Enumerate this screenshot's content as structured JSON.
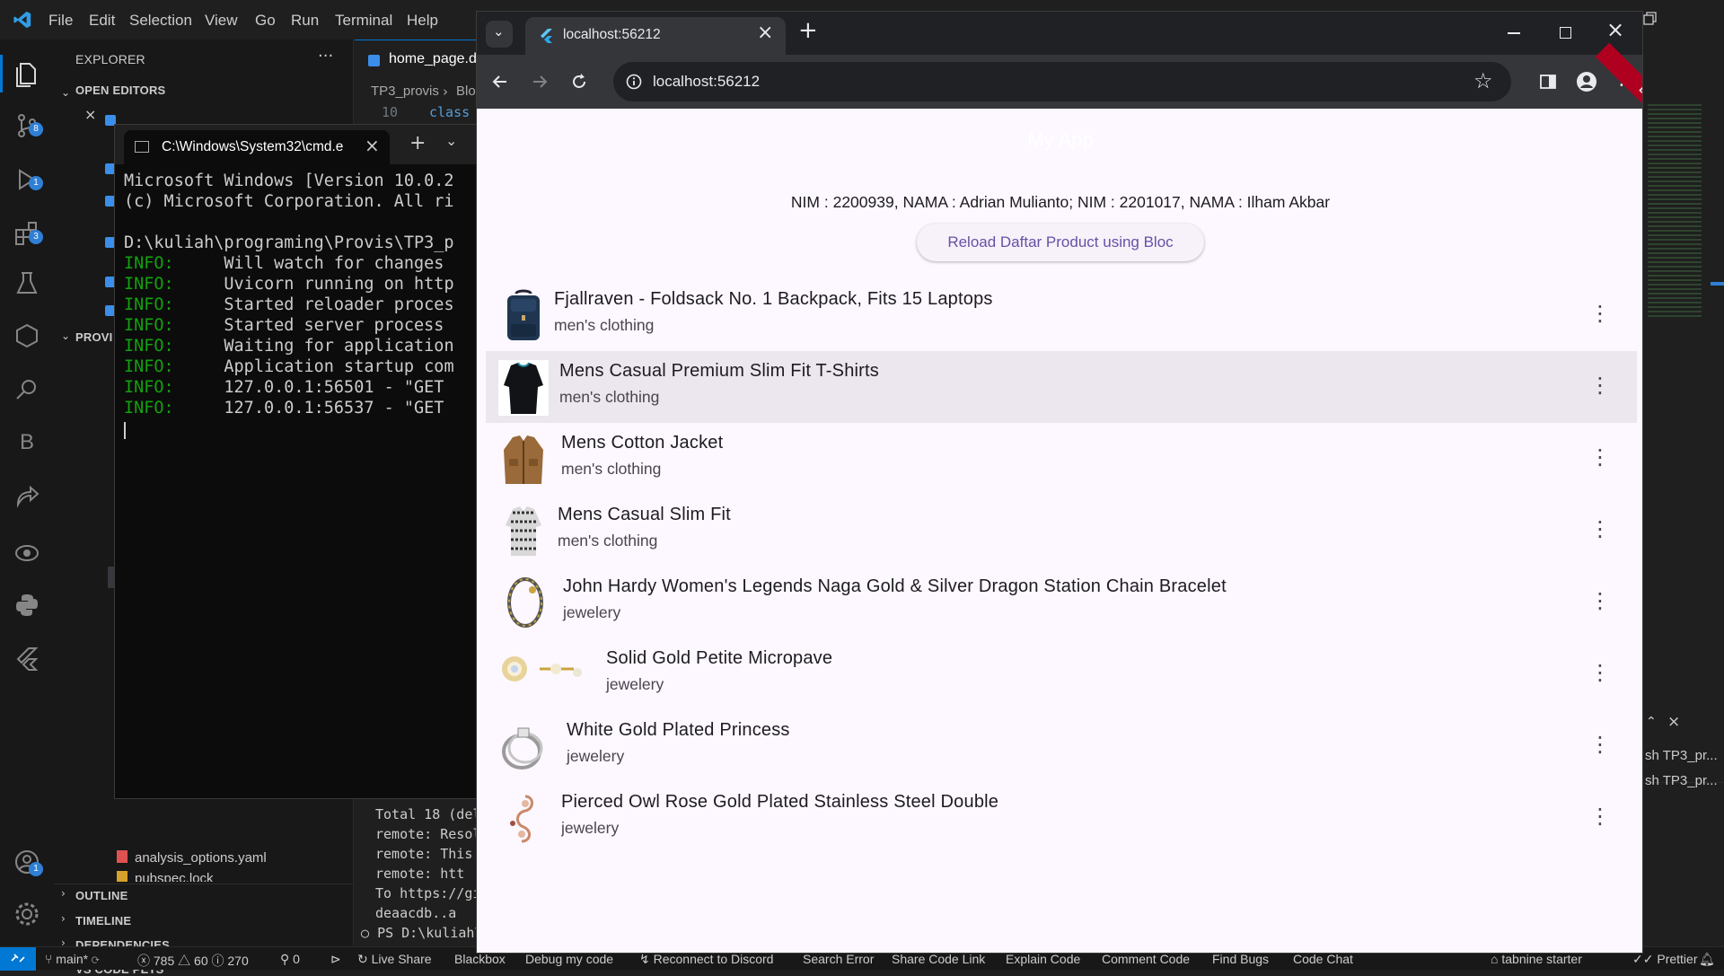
{
  "vscode": {
    "menu": [
      "File",
      "Edit",
      "Selection",
      "View",
      "Go",
      "Run",
      "Terminal",
      "Help"
    ],
    "badges": {
      "source_control": "8",
      "run_debug": "1",
      "extensions": "3",
      "accounts": "1"
    },
    "sidebar": {
      "explorer_title": "EXPLORER",
      "open_editors": "OPEN EDITORS",
      "project_header": "PROVI",
      "files": [
        "analysis_options.yaml",
        "pubspec.lock"
      ],
      "sections": [
        "OUTLINE",
        "TIMELINE",
        "DEPENDENCIES",
        "VS CODE PETS"
      ]
    },
    "editor_tab": "home_page.d",
    "breadcrumb": {
      "root": "TP3_provis",
      "next": "Blo"
    },
    "code_snippet": {
      "line_no": "10",
      "keyword": "class"
    },
    "terminal_lines": [
      "Total 18 (del",
      "remote: Resol",
      "remote: This",
      "remote:   htt",
      "To https://gi",
      "   deaacdb..a",
      "PS D:\\kuliah\\"
    ],
    "terminal_panel_items": [
      "TP3_pr...",
      "TP3_pr..."
    ],
    "statusbar": {
      "branch": "main*",
      "errors": "785",
      "warnings": "60",
      "infos": "270",
      "ports": "0",
      "items": [
        "Live Share",
        "Blackbox",
        "Debug my code",
        "Reconnect to Discord",
        "Search Error",
        "Share Code Link",
        "Explain Code",
        "Comment Code",
        "Find Bugs",
        "Code Chat"
      ],
      "right_items": [
        "tabnine starter",
        "Prettier"
      ]
    }
  },
  "cmd": {
    "tab_title": "C:\\Windows\\System32\\cmd.e",
    "header_lines": [
      "Microsoft Windows [Version 10.0.2",
      "(c) Microsoft Corporation. All ri"
    ],
    "path_line": "D:\\kuliah\\programing\\Provis\\TP3_p",
    "info_label": "INFO:",
    "info_lines": [
      "Will watch for changes",
      "Uvicorn running on http",
      "Started reloader proces",
      "Started server process",
      "Waiting for application",
      "Application startup com",
      "127.0.0.1:56501 - \"GET",
      "127.0.0.1:56537 - \"GET"
    ]
  },
  "browser": {
    "tab_title": "localhost:56212",
    "url": "localhost:56212",
    "app": {
      "title": "My App",
      "debug_banner": "DEBUG",
      "nim_text": "NIM : 2200939, NAMA : Adrian Mulianto; NIM : 2201017, NAMA : Ilham Akbar",
      "reload_button": "Reload Daftar Product using Bloc",
      "products": [
        {
          "title": "Fjallraven - Foldsack No. 1 Backpack, Fits 15 Laptops",
          "category": "men's clothing",
          "image": "backpack-image"
        },
        {
          "title": "Mens Casual Premium Slim Fit T-Shirts",
          "category": "men's clothing",
          "image": "tshirt-image"
        },
        {
          "title": "Mens Cotton Jacket",
          "category": "men's clothing",
          "image": "jacket-image"
        },
        {
          "title": "Mens Casual Slim Fit",
          "category": "men's clothing",
          "image": "shirt-image"
        },
        {
          "title": "John Hardy Women's Legends Naga Gold & Silver Dragon Station Chain Bracelet",
          "category": "jewelery",
          "image": "bracelet-image"
        },
        {
          "title": "Solid Gold Petite Micropave",
          "category": "jewelery",
          "image": "earrings-image"
        },
        {
          "title": "White Gold Plated Princess",
          "category": "jewelery",
          "image": "ring-image"
        },
        {
          "title": "Pierced Owl Rose Gold Plated Stainless Steel Double",
          "category": "jewelery",
          "image": "earring-image"
        }
      ]
    }
  },
  "colors": {
    "vscode_bg": "#1f1f1f",
    "cmd_info_green": "#13a10e",
    "flutter_purple": "#6750a4",
    "debug_red": "#b00020"
  }
}
